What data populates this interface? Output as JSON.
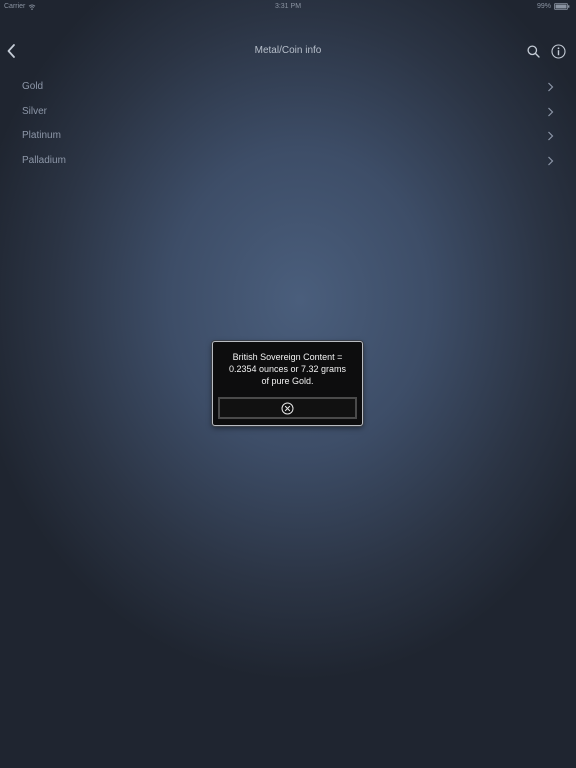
{
  "status_bar": {
    "carrier": "Carrier",
    "time": "3:31 PM",
    "battery": "99%"
  },
  "nav": {
    "title": "Metal/Coin info",
    "back_icon": "chevron-left-icon",
    "search_icon": "search-icon",
    "info_icon": "info-icon"
  },
  "metals": [
    {
      "label": "Gold"
    },
    {
      "label": "Silver"
    },
    {
      "label": "Platinum"
    },
    {
      "label": "Palladium"
    }
  ],
  "alert": {
    "lines": [
      "British Sovereign Content =",
      "0.2354 ounces or 7.32 grams",
      "of pure Gold."
    ],
    "close_icon": "close-circle-icon"
  },
  "colors": {
    "background_center": "#4a5e7c",
    "background_edge": "#1f2530",
    "alert_background": "#0d0d0e",
    "alert_border": "#b9bcc2"
  }
}
